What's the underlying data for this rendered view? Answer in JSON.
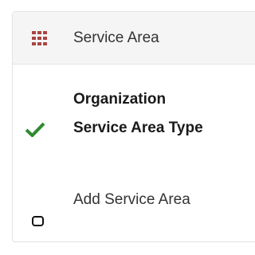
{
  "header": {
    "label": "Service Area",
    "icon": "grid-icon",
    "icon_color": "#a94442"
  },
  "steps": [
    {
      "label": "Organization Service Area Type",
      "status": "complete",
      "icon": "checkmark-icon",
      "icon_color": "#2e8b2e"
    },
    {
      "label": "Add Service Area",
      "status": "pending",
      "icon": "circle-icon"
    }
  ]
}
